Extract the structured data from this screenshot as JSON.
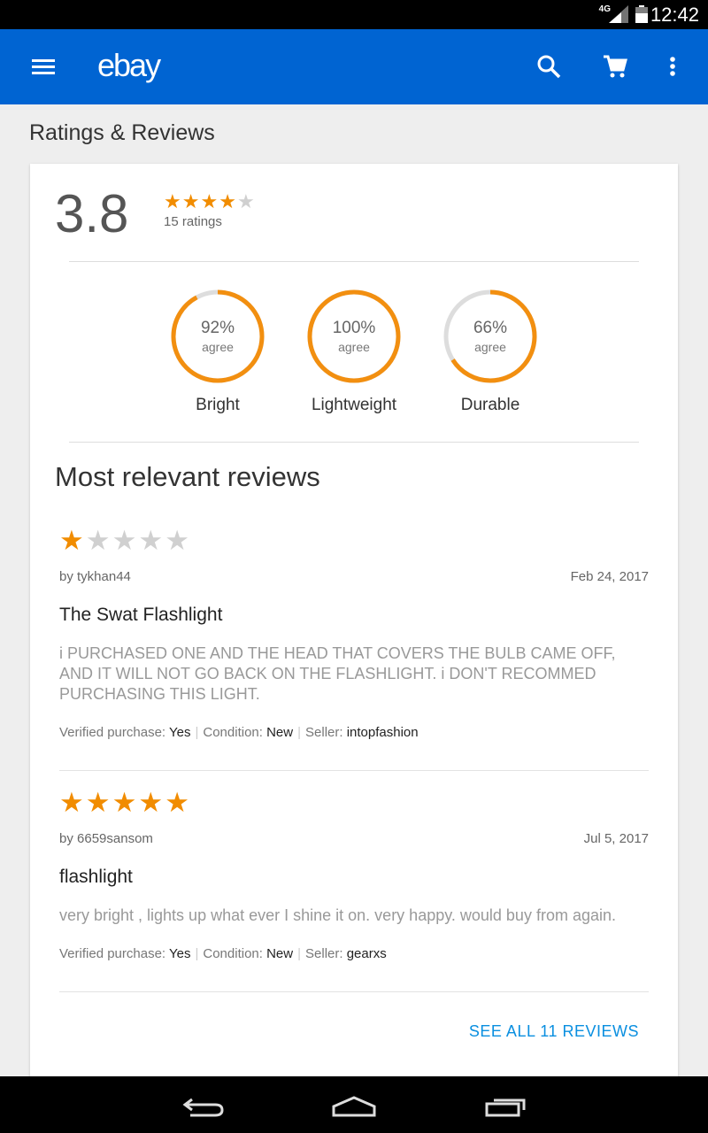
{
  "status_bar": {
    "network": "4G",
    "time": "12:42"
  },
  "app_bar": {
    "logo": "ebay",
    "icons": [
      "menu-icon",
      "search-icon",
      "cart-icon",
      "more-vert-icon"
    ],
    "color": "#0064d2"
  },
  "page": {
    "title": "Ratings & Reviews"
  },
  "summary": {
    "average": "3.8",
    "stars": 4,
    "ratings_count": "15 ratings"
  },
  "aspects": [
    {
      "percent": "92%",
      "agree": "agree",
      "name": "Bright",
      "value": 0.92
    },
    {
      "percent": "100%",
      "agree": "agree",
      "name": "Lightweight",
      "value": 1.0
    },
    {
      "percent": "66%",
      "agree": "agree",
      "name": "Durable",
      "value": 0.66
    }
  ],
  "reviews_section": {
    "title": "Most relevant reviews"
  },
  "reviews": [
    {
      "stars": 1,
      "by": "by tykhan44",
      "date": "Feb 24, 2017",
      "title": "The Swat Flashlight",
      "body": "i PURCHASED ONE AND THE HEAD THAT COVERS THE BULB CAME OFF, AND IT WILL NOT GO BACK ON THE FLASHLIGHT. i DON'T RECOMMED PURCHASING THIS LIGHT.",
      "verified_label": "Verified purchase:",
      "verified": "Yes",
      "condition_label": "Condition:",
      "condition": "New",
      "seller_label": "Seller:",
      "seller": "intopfashion"
    },
    {
      "stars": 5,
      "by": "by 6659sansom",
      "date": "Jul 5, 2017",
      "title": "flashlight",
      "body": "very bright , lights up what ever I shine it on. very happy. would buy from again.",
      "verified_label": "Verified purchase:",
      "verified": "Yes",
      "condition_label": "Condition:",
      "condition": "New",
      "seller_label": "Seller:",
      "seller": "gearxs"
    }
  ],
  "see_all": "SEE ALL 11 REVIEWS",
  "colors": {
    "star_filled": "#f18c00",
    "star_empty": "#d0d0d0",
    "ring": "#f28f10",
    "ring_track": "#dddddd",
    "link": "#0a8fe0"
  },
  "nav_bar": {
    "icons": [
      "back-icon",
      "home-icon",
      "recent-apps-icon"
    ]
  }
}
